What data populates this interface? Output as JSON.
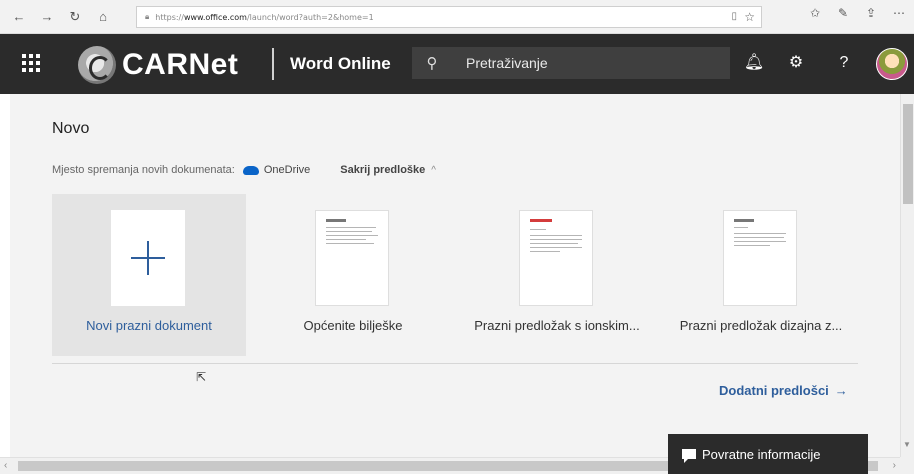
{
  "browser": {
    "url_prefix": "https://",
    "url_domain": "www.office.com",
    "url_path": "/launch/word?auth=2&home=1",
    "icons": [
      "back-icon",
      "forward-icon",
      "refresh-icon",
      "home-icon",
      "lock-icon",
      "reading-view-icon",
      "favorite-star-icon",
      "favorites-icon",
      "pen-icon",
      "share-icon",
      "more-icon"
    ]
  },
  "header": {
    "brand": "CARNet",
    "app_name": "Word Online",
    "search_placeholder": "Pretraživanje",
    "help_label": "?",
    "background_color": "#2b2b2b"
  },
  "main": {
    "section_title": "Novo",
    "save_location_label": "Mjesto spremanja novih dokumenata:",
    "save_location_value": "OneDrive",
    "toggle_templates_label": "Sakrij predloške",
    "templates": [
      {
        "label": "Novi prazni dokument",
        "selected": true
      },
      {
        "label": "Općenite bilješke",
        "selected": false
      },
      {
        "label": "Prazni predložak s ionskim...",
        "selected": false
      },
      {
        "label": "Prazni predložak dizajna z...",
        "selected": false
      }
    ],
    "more_templates_label": "Dodatni predlošci",
    "accent_color": "#2e5e9c"
  },
  "feedback": {
    "label": "Povratne informacije"
  }
}
